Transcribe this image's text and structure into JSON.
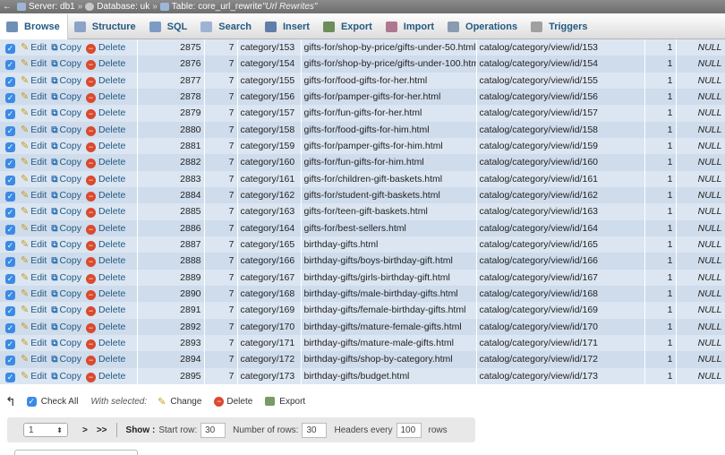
{
  "breadcrumb": {
    "server": "Server: db1",
    "database": "Database: uk",
    "table": "Table: core_url_rewrite",
    "comment": "\"Url Rewrites\"",
    "separator": "»"
  },
  "tabs": [
    {
      "label": "Browse",
      "icon": "browse-icon",
      "color": "#6f8fb8"
    },
    {
      "label": "Structure",
      "icon": "structure-icon",
      "color": "#8aa4c6"
    },
    {
      "label": "SQL",
      "icon": "sql-icon",
      "color": "#7d9bc2"
    },
    {
      "label": "Search",
      "icon": "search-icon",
      "color": "#9db3d3"
    },
    {
      "label": "Insert",
      "icon": "insert-icon",
      "color": "#5f7ea8"
    },
    {
      "label": "Export",
      "icon": "export-icon",
      "color": "#6d8d5a"
    },
    {
      "label": "Import",
      "icon": "import-icon",
      "color": "#b07890"
    },
    {
      "label": "Operations",
      "icon": "operations-icon",
      "color": "#8a9bb0"
    },
    {
      "label": "Triggers",
      "icon": "triggers-icon",
      "color": "#a0a0a0"
    }
  ],
  "row_actions": {
    "edit": "Edit",
    "copy": "Copy",
    "delete": "Delete"
  },
  "rows": [
    {
      "id": "2875",
      "store": "7",
      "id_path": "category/153",
      "request_path": "gifts-for/shop-by-price/gifts-under-50.html",
      "target_path": "catalog/category/view/id/153",
      "is_system": "1",
      "options": "NULL"
    },
    {
      "id": "2876",
      "store": "7",
      "id_path": "category/154",
      "request_path": "gifts-for/shop-by-price/gifts-under-100.html",
      "target_path": "catalog/category/view/id/154",
      "is_system": "1",
      "options": "NULL"
    },
    {
      "id": "2877",
      "store": "7",
      "id_path": "category/155",
      "request_path": "gifts-for/food-gifts-for-her.html",
      "target_path": "catalog/category/view/id/155",
      "is_system": "1",
      "options": "NULL"
    },
    {
      "id": "2878",
      "store": "7",
      "id_path": "category/156",
      "request_path": "gifts-for/pamper-gifts-for-her.html",
      "target_path": "catalog/category/view/id/156",
      "is_system": "1",
      "options": "NULL"
    },
    {
      "id": "2879",
      "store": "7",
      "id_path": "category/157",
      "request_path": "gifts-for/fun-gifts-for-her.html",
      "target_path": "catalog/category/view/id/157",
      "is_system": "1",
      "options": "NULL"
    },
    {
      "id": "2880",
      "store": "7",
      "id_path": "category/158",
      "request_path": "gifts-for/food-gifts-for-him.html",
      "target_path": "catalog/category/view/id/158",
      "is_system": "1",
      "options": "NULL"
    },
    {
      "id": "2881",
      "store": "7",
      "id_path": "category/159",
      "request_path": "gifts-for/pamper-gifts-for-him.html",
      "target_path": "catalog/category/view/id/159",
      "is_system": "1",
      "options": "NULL"
    },
    {
      "id": "2882",
      "store": "7",
      "id_path": "category/160",
      "request_path": "gifts-for/fun-gifts-for-him.html",
      "target_path": "catalog/category/view/id/160",
      "is_system": "1",
      "options": "NULL"
    },
    {
      "id": "2883",
      "store": "7",
      "id_path": "category/161",
      "request_path": "gifts-for/children-gift-baskets.html",
      "target_path": "catalog/category/view/id/161",
      "is_system": "1",
      "options": "NULL"
    },
    {
      "id": "2884",
      "store": "7",
      "id_path": "category/162",
      "request_path": "gifts-for/student-gift-baskets.html",
      "target_path": "catalog/category/view/id/162",
      "is_system": "1",
      "options": "NULL"
    },
    {
      "id": "2885",
      "store": "7",
      "id_path": "category/163",
      "request_path": "gifts-for/teen-gift-baskets.html",
      "target_path": "catalog/category/view/id/163",
      "is_system": "1",
      "options": "NULL"
    },
    {
      "id": "2886",
      "store": "7",
      "id_path": "category/164",
      "request_path": "gifts-for/best-sellers.html",
      "target_path": "catalog/category/view/id/164",
      "is_system": "1",
      "options": "NULL"
    },
    {
      "id": "2887",
      "store": "7",
      "id_path": "category/165",
      "request_path": "birthday-gifts.html",
      "target_path": "catalog/category/view/id/165",
      "is_system": "1",
      "options": "NULL"
    },
    {
      "id": "2888",
      "store": "7",
      "id_path": "category/166",
      "request_path": "birthday-gifts/boys-birthday-gift.html",
      "target_path": "catalog/category/view/id/166",
      "is_system": "1",
      "options": "NULL"
    },
    {
      "id": "2889",
      "store": "7",
      "id_path": "category/167",
      "request_path": "birthday-gifts/girls-birthday-gift.html",
      "target_path": "catalog/category/view/id/167",
      "is_system": "1",
      "options": "NULL"
    },
    {
      "id": "2890",
      "store": "7",
      "id_path": "category/168",
      "request_path": "birthday-gifts/male-birthday-gifts.html",
      "target_path": "catalog/category/view/id/168",
      "is_system": "1",
      "options": "NULL"
    },
    {
      "id": "2891",
      "store": "7",
      "id_path": "category/169",
      "request_path": "birthday-gifts/female-birthday-gifts.html",
      "target_path": "catalog/category/view/id/169",
      "is_system": "1",
      "options": "NULL"
    },
    {
      "id": "2892",
      "store": "7",
      "id_path": "category/170",
      "request_path": "birthday-gifts/mature-female-gifts.html",
      "target_path": "catalog/category/view/id/170",
      "is_system": "1",
      "options": "NULL"
    },
    {
      "id": "2893",
      "store": "7",
      "id_path": "category/171",
      "request_path": "birthday-gifts/mature-male-gifts.html",
      "target_path": "catalog/category/view/id/171",
      "is_system": "1",
      "options": "NULL"
    },
    {
      "id": "2894",
      "store": "7",
      "id_path": "category/172",
      "request_path": "birthday-gifts/shop-by-category.html",
      "target_path": "catalog/category/view/id/172",
      "is_system": "1",
      "options": "NULL"
    },
    {
      "id": "2895",
      "store": "7",
      "id_path": "category/173",
      "request_path": "birthday-gifts/budget.html",
      "target_path": "catalog/category/view/id/173",
      "is_system": "1",
      "options": "NULL"
    }
  ],
  "bulk": {
    "check_all": "Check All",
    "with_selected": "With selected:",
    "change": "Change",
    "delete": "Delete",
    "export": "Export"
  },
  "pager": {
    "page_value": "1",
    "next": ">",
    "last": ">>",
    "show_label": "Show :",
    "start_row_label": "Start row:",
    "start_row_value": "30",
    "num_rows_label": "Number of rows:",
    "num_rows_value": "30",
    "headers_label": "Headers every",
    "headers_value": "100",
    "rows_label": "rows"
  }
}
